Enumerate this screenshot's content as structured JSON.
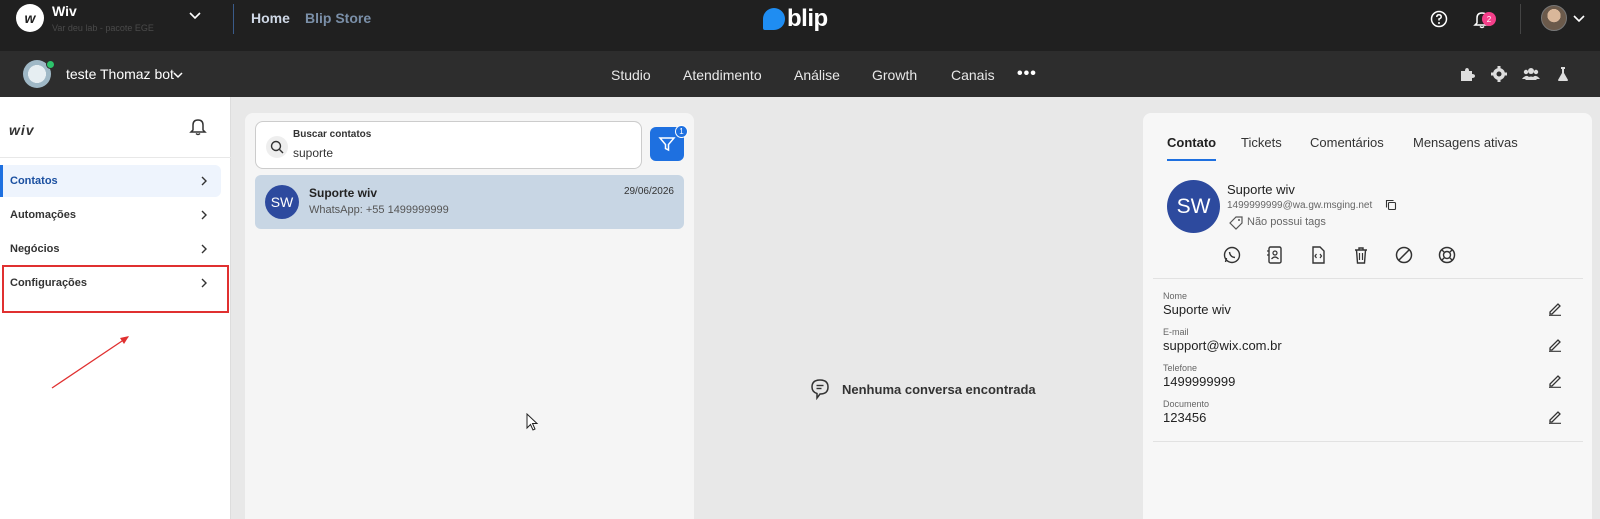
{
  "topbar": {
    "org_logo": "w",
    "org_name": "Wiv",
    "org_sub": "Var deu lab - pacote EGE",
    "home": "Home",
    "store": "Blip Store",
    "brand": "blip",
    "notification_count": "2"
  },
  "subbar": {
    "bot_name": "teste Thomaz bot",
    "nav": [
      "Studio",
      "Atendimento",
      "Análise",
      "Growth",
      "Canais"
    ],
    "more": "•••"
  },
  "sidebar": {
    "logo": "wiv",
    "items": [
      {
        "label": "Contatos"
      },
      {
        "label": "Automações"
      },
      {
        "label": "Negócios"
      },
      {
        "label": "Configurações"
      }
    ]
  },
  "search": {
    "label": "Buscar contatos",
    "value": "suporte",
    "filter_count": "1"
  },
  "contact": {
    "initials": "SW",
    "name": "Suporte wiv",
    "sub": "WhatsApp: +55 1499999999",
    "date": "29/06/2026"
  },
  "empty": {
    "message": "Nenhuma conversa encontrada"
  },
  "detail": {
    "tabs": [
      "Contato",
      "Tickets",
      "Comentários",
      "Mensagens ativas"
    ],
    "initials": "SW",
    "name": "Suporte wiv",
    "address": "1499999999@wa.gw.msging.net",
    "tags": "Não possui tags",
    "fields": [
      {
        "label": "Nome",
        "value": "Suporte wiv"
      },
      {
        "label": "E-mail",
        "value": "support@wix.com.br"
      },
      {
        "label": "Telefone",
        "value": "1499999999"
      },
      {
        "label": "Documento",
        "value": "123456"
      }
    ]
  },
  "colors": {
    "accent": "#1e70e0",
    "avatar": "#2d4a9e",
    "highlight": "#e03030"
  }
}
